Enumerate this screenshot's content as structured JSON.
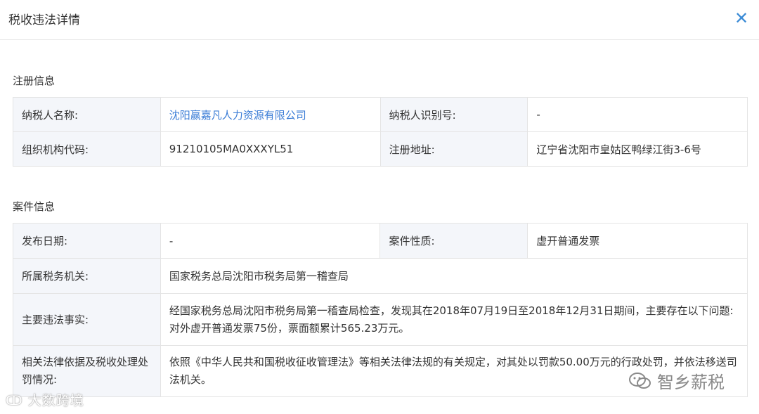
{
  "dialog": {
    "title": "税收违法详情",
    "close_icon": "close-icon"
  },
  "registration": {
    "heading": "注册信息",
    "taxpayer_name_label": "纳税人名称:",
    "taxpayer_name_value": "沈阳赢嘉凡人力资源有限公司",
    "taxpayer_id_label": "纳税人识别号:",
    "taxpayer_id_value": "-",
    "org_code_label": "组织机构代码:",
    "org_code_value": "91210105MA0XXXYL51",
    "address_label": "注册地址:",
    "address_value": "辽宁省沈阳市皇姑区鸭绿江街3-6号"
  },
  "case": {
    "heading": "案件信息",
    "publish_date_label": "发布日期:",
    "publish_date_value": "-",
    "case_nature_label": "案件性质:",
    "case_nature_value": "虚开普通发票",
    "tax_authority_label": "所属税务机关:",
    "tax_authority_value": "国家税务总局沈阳市税务局第一稽查局",
    "main_facts_label": "主要违法事实:",
    "main_facts_value": "经国家税务总局沈阳市税务局第一稽查局检查，发现其在2018年07月19日至2018年12月31日期间，主要存在以下问题:对外虚开普通发票75份，票面额累计565.23万元。",
    "legal_basis_label": "相关法律依据及税收处理处罚情况:",
    "legal_basis_value": "依照《中华人民共和国税收征收管理法》等相关法律法规的有关规定，对其处以罚款50.00万元的行政处罚，并依法移送司法机关。"
  },
  "watermarks": {
    "left_text": "大数跨境",
    "right_text": "智乡薪税"
  },
  "colors": {
    "accent": "#3b8bd6",
    "link": "#3a7cd6",
    "label_bg": "#f4f6fa",
    "border": "#e4e4e4"
  }
}
